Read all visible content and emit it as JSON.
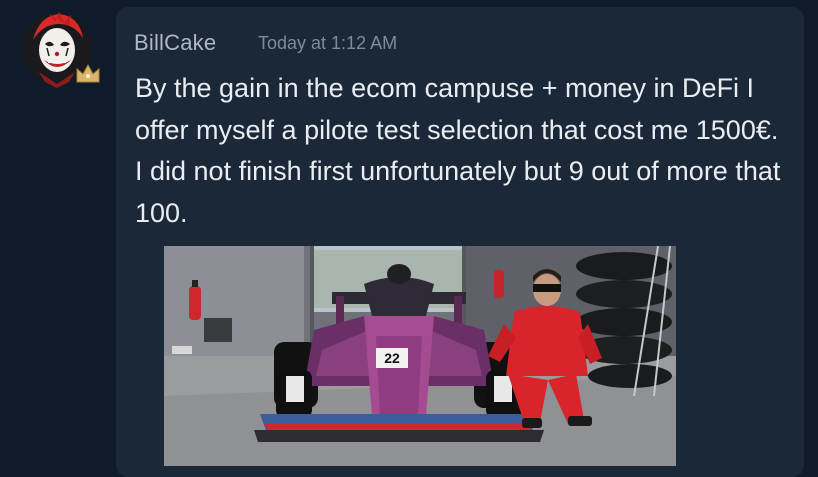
{
  "post": {
    "author": "BillCake",
    "timestamp": "Today at 1:12 AM",
    "message": "By the gain in the ecom campuse + money in DeFi I offer myself a pilote test selection that cost me 1500€. I did not finish first unfortunately but 9 out of more that 100.",
    "avatar_icon": "joker-face-icon",
    "avatar_badge_icon": "crown-icon",
    "attachment": {
      "car_number": "22",
      "description_icons": [
        "race-car-icon",
        "fire-extinguisher-icon",
        "tire-stack-icon"
      ]
    }
  },
  "colors": {
    "background": "#101b29",
    "card": "#1b2838",
    "username": "#aeb8c4",
    "timestamp": "#7f8b99",
    "message": "#e9edf2",
    "car_primary": "#6a2f66",
    "suit_red": "#d8242a"
  }
}
